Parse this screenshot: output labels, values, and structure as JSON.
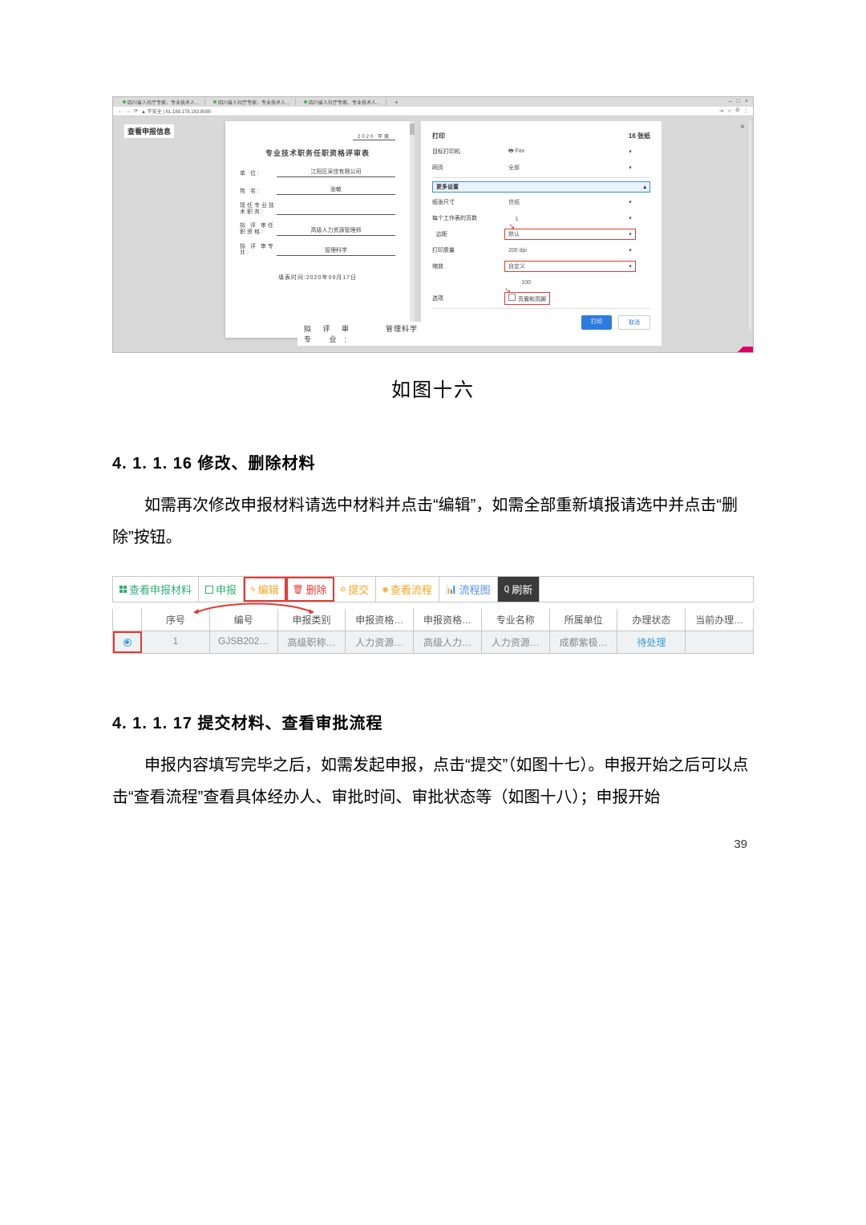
{
  "browser": {
    "tab_label": "四川省人社厅专家、专业技术人…",
    "url": "61.188.178.163:8080",
    "insecure": "不安全",
    "window_min": "–",
    "window_max": "□",
    "window_close": "×",
    "back": "←",
    "fwd": "→",
    "reload": "⟳",
    "profile": "Θ",
    "star": "☆",
    "menu": "⋮"
  },
  "modal": {
    "sidebar_title": "查看申报信息",
    "close": "×",
    "footer_line1": "拟 评 审",
    "footer_line2": "专    业:",
    "footer_right": "管理科学"
  },
  "form": {
    "year_line": "2020   年度",
    "title": "专业技术职务任职资格评审表",
    "rows": {
      "danwei": {
        "label": "单    位:",
        "value": "江阳区采佳有限公司"
      },
      "xingming": {
        "label": "姓    名:",
        "value": "张敏"
      },
      "xrzyjszw": {
        "label": "现任专业技术职务:",
        "value": ""
      },
      "npsrzzg": {
        "label": "拟 评 审任职资格:",
        "value": "高级人力资源管理师"
      },
      "npszy": {
        "label": "拟 评 审专    业:",
        "value": "管理科学"
      }
    },
    "date": "填表时间:2020年09月17日"
  },
  "print": {
    "title": "打印",
    "pages": "16 张纸",
    "close": "×",
    "dest_label": "目标打印机",
    "dest_value": "Fax",
    "fax_icon": "🖶",
    "pages_label": "网页",
    "pages_value": "全部",
    "more_label": "更多设置",
    "chev_up": "▴",
    "papersize_label": "纸张尺寸",
    "papersize_value": "信纸",
    "ppp_label": "每个工作表的页数",
    "ppp_value": "1",
    "margin_label": "边距",
    "margin_value": "默认",
    "quality_label": "打印质量",
    "quality_value": "200 dpi",
    "scale_label": "缩放",
    "scale_value": "自定义",
    "scale_input": "100",
    "opt_label": "选项",
    "opt_value": "页眉和页脚",
    "btn_print": "打印",
    "btn_cancel": "取消",
    "caret": "▾"
  },
  "caption1": "如图十六",
  "sec1": {
    "heading": "4. 1. 1. 16 修改、删除材料",
    "body": "如需再次修改申报材料请选中材料并点击“编辑”，如需全部重新填报请选中并点击“删除”按钮。"
  },
  "toolbar": {
    "view": "查看申报材料",
    "apply": "申报",
    "edit": "编辑",
    "delete": "删除",
    "submit": "提交",
    "flow": "查看流程",
    "chart": "流程图",
    "refresh": "刷新",
    "pencil": "✎",
    "trash": "🗑",
    "stop": "⊘",
    "eye": "◉",
    "barchart": "📊",
    "mag": "Q"
  },
  "table": {
    "headers": {
      "seq": "序号",
      "code": "编号",
      "type": "申报类别",
      "qual1": "申报资格…",
      "qual2": "申报资格…",
      "major": "专业名称",
      "unit": "所属单位",
      "pstatus": "办理状态",
      "curr": "当前办理…"
    },
    "row": {
      "seq": "1",
      "code": "GJSB202…",
      "type": "高级职称…",
      "qual1": "人力资源…",
      "qual2": "高级人力…",
      "major": "人力资源…",
      "unit": "成都紫极…",
      "pstatus": "待处理",
      "curr": ""
    }
  },
  "sec2": {
    "heading": "4. 1. 1. 17 提交材料、查看审批流程",
    "body": "申报内容填写完毕之后，如需发起申报，点击“提交”（如图十七）。申报开始之后可以点击“查看流程”查看具体经办人、审批时间、审批状态等（如图十八）；申报开始"
  },
  "page_no": "39"
}
